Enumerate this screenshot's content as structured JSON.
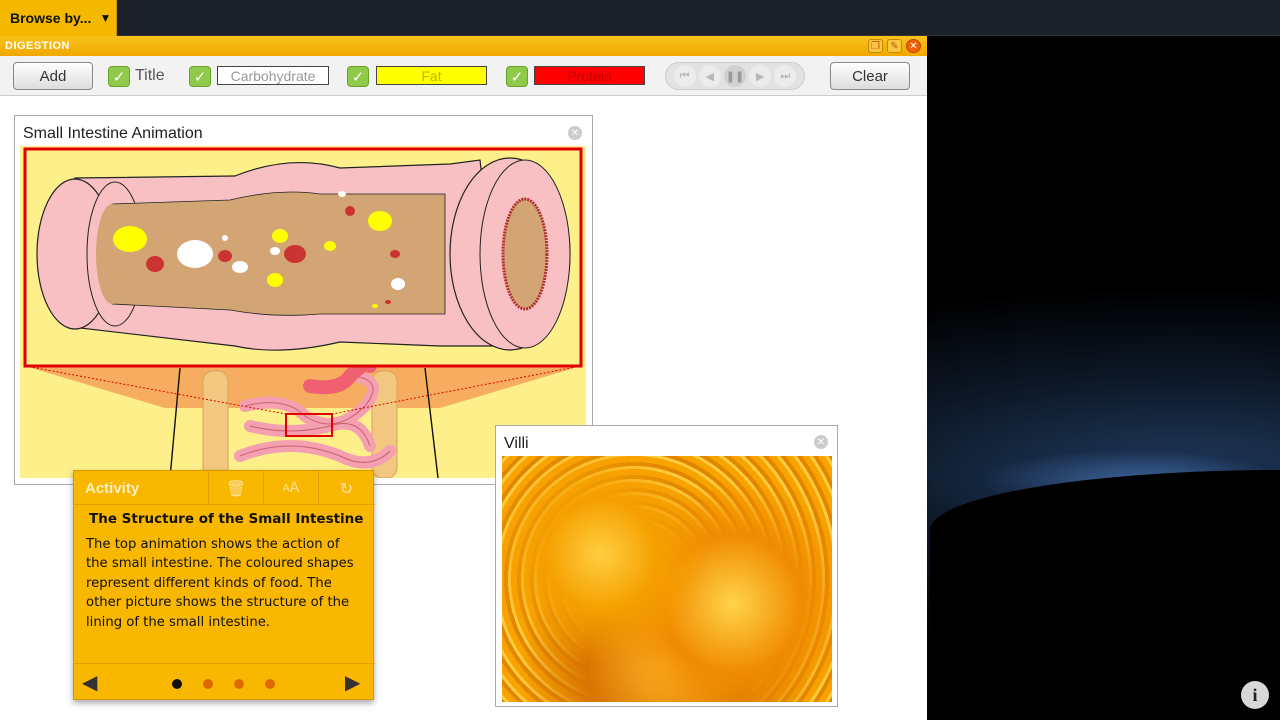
{
  "topbar": {
    "browse_label": "Browse by...",
    "caret": "▼"
  },
  "app": {
    "title": "DIGESTION"
  },
  "toolbar": {
    "add_label": "Add",
    "title_label": "Title",
    "carbohydrate_label": "Carbohydrate",
    "fat_label": "Fat",
    "protein_label": "Protein",
    "clear_label": "Clear",
    "check": "✓",
    "colors": {
      "fat": "#ffff00",
      "protein": "#ff0000"
    }
  },
  "playback": [
    "⏮",
    "◀",
    "❚❚",
    "▶",
    "⏭"
  ],
  "animation_panel": {
    "title": "Small Intestine Animation"
  },
  "villi_panel": {
    "title": "Villi"
  },
  "activity": {
    "label": "Activity",
    "icons": [
      "trash-icon",
      "text-size-icon",
      "reset-icon"
    ],
    "heading": "The Structure of the Small Intestine",
    "body": "The top animation shows the action of the small intestine. The coloured shapes represent different kinds of food. The other picture shows the structure of the lining of the small intestine.",
    "prev": "◀",
    "next": "▶",
    "dots": 4,
    "active_dot": 0
  },
  "info": "i"
}
